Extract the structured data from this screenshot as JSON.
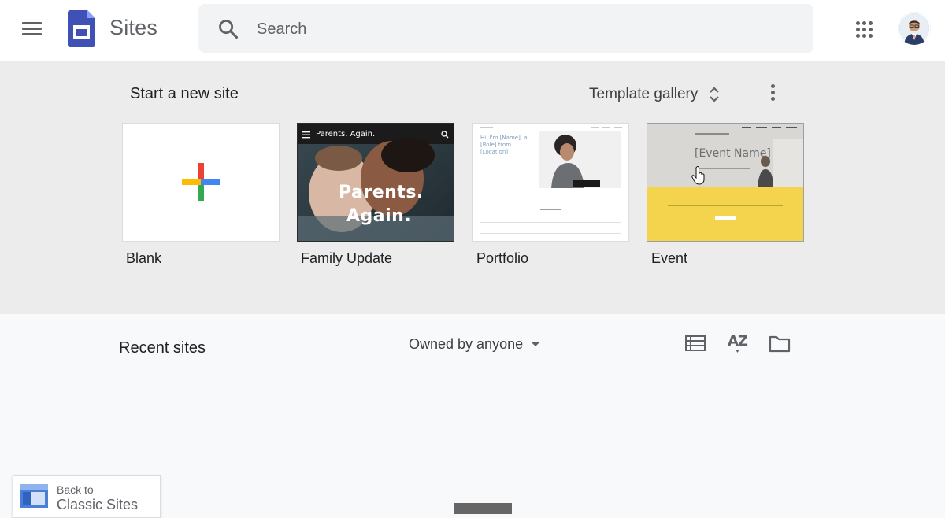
{
  "header": {
    "app_title": "Sites",
    "search_placeholder": "Search",
    "icons": [
      "menu-icon",
      "sites-logo-icon",
      "search-icon",
      "apps-grid-icon",
      "avatar"
    ]
  },
  "templates": {
    "title": "Start a new site",
    "gallery_label": "Template gallery",
    "cards": [
      {
        "label": "Blank"
      },
      {
        "label": "Family Update",
        "thumb_header": "Parents, Again.",
        "thumb_line1": "Parents.",
        "thumb_line2": "Again."
      },
      {
        "label": "Portfolio",
        "thumb_intro": "Hi, I'm [Name], a [Role] from [Location]"
      },
      {
        "label": "Event",
        "thumb_title": "[Event Name]"
      }
    ]
  },
  "recent": {
    "title": "Recent sites",
    "owner_filter": "Owned by anyone",
    "sort_label": "AZ"
  },
  "classic": {
    "line1": "Back to",
    "line2": "Classic Sites"
  },
  "colors": {
    "header_bg": "#ffffff",
    "template_bg": "#ececec",
    "page_bg": "#f8f9fa",
    "sites_purple": "#3f51b5",
    "event_yellow": "#f3d44c"
  }
}
